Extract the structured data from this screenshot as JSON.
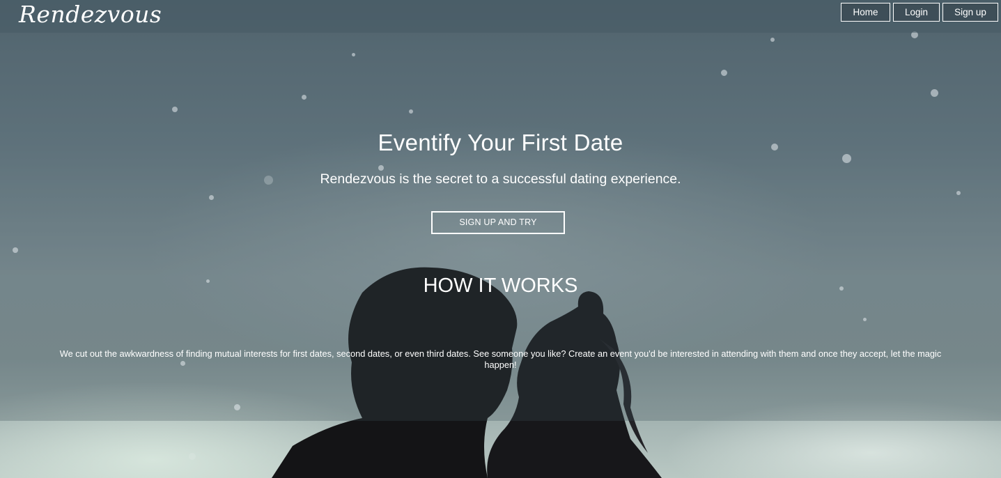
{
  "navbar": {
    "brand": "Rendezvous",
    "links": [
      "Home",
      "Login",
      "Sign up"
    ]
  },
  "hero": {
    "title": "Eventify Your First Date",
    "subtitle": "Rendezvous is the secret to a successful dating experience.",
    "cta_label": "SIGN UP AND TRY"
  },
  "how_it_works": {
    "title": "HOW IT WORKS",
    "body": "We cut out the awkwardness of finding mutual interests for first dates, second dates, or even third dates. See someone you like? Create an event you'd be interested in attending with them and once they accept, let the magic happen!"
  }
}
